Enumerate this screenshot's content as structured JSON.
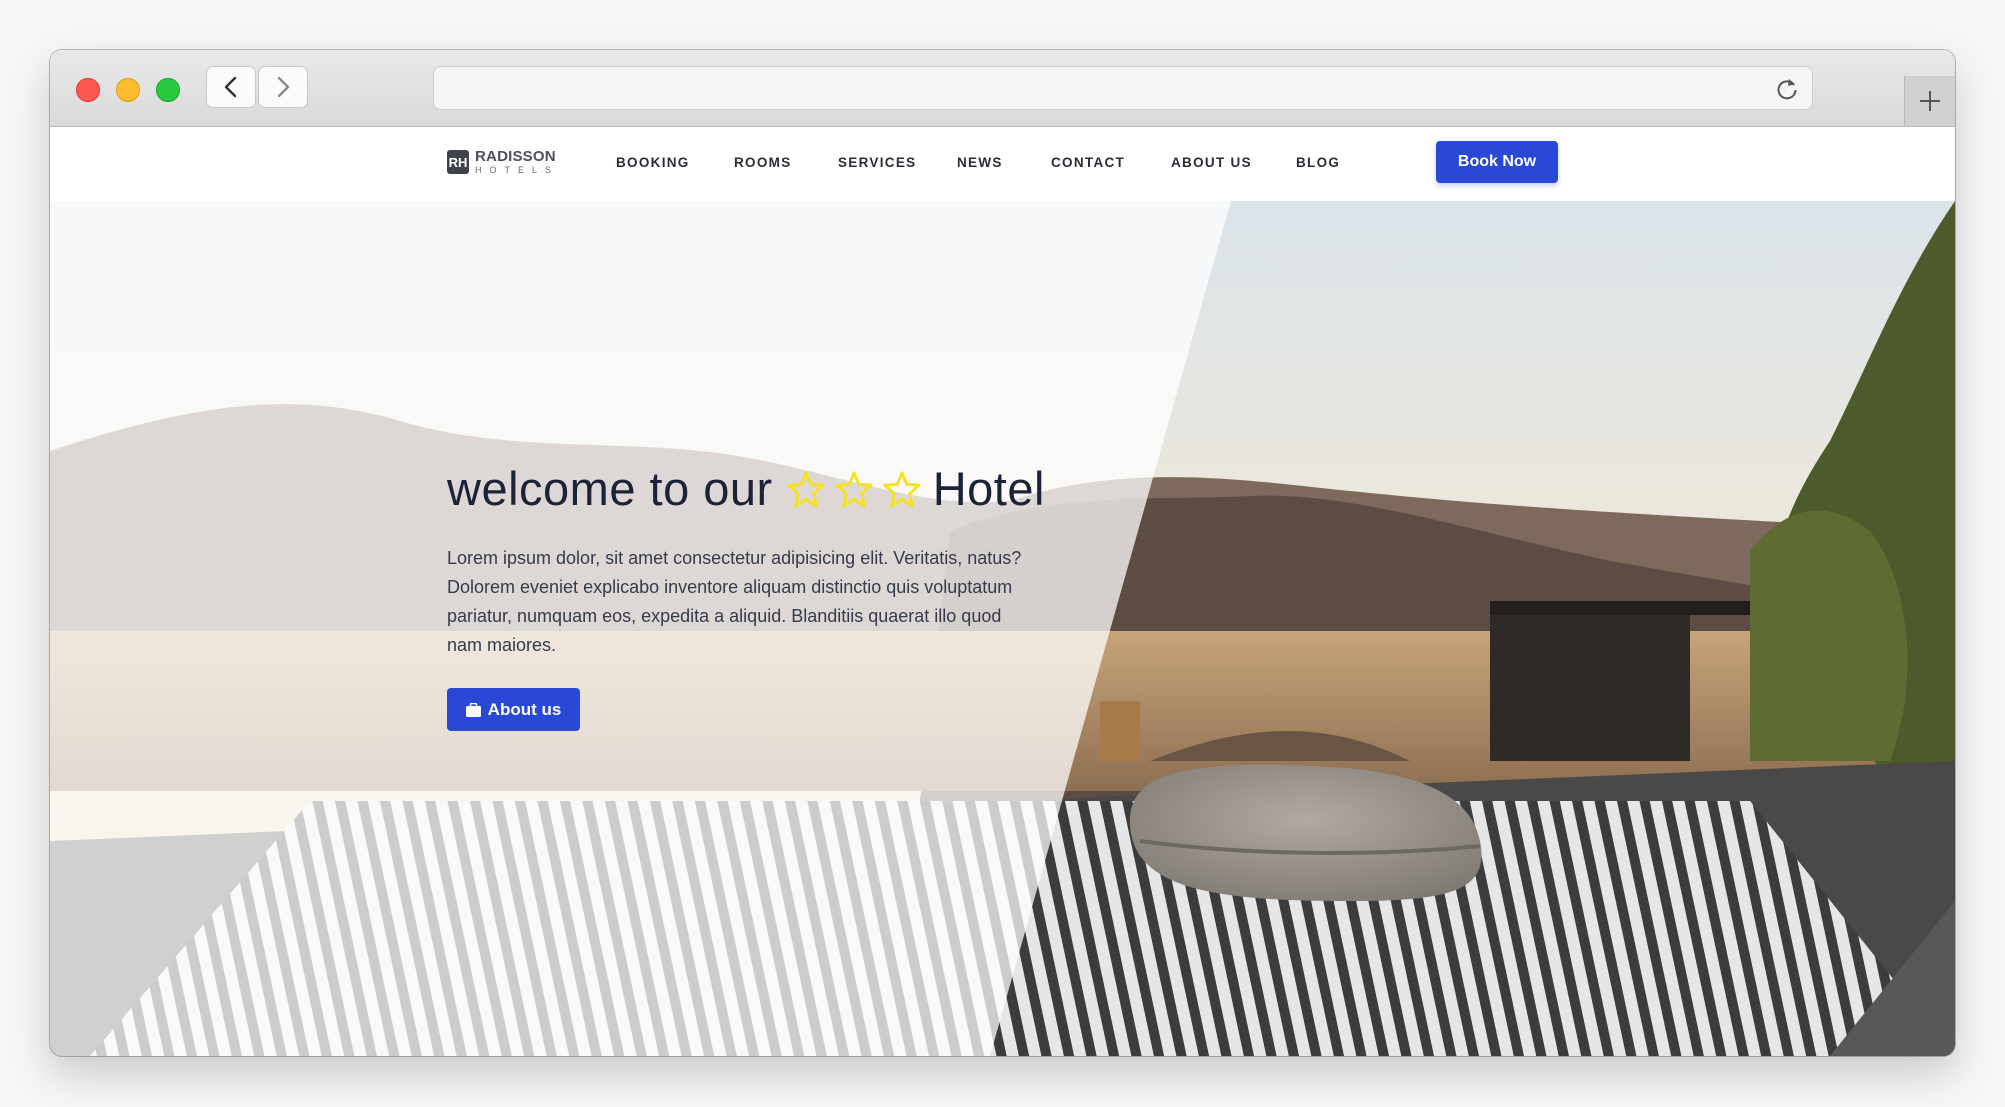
{
  "site": {
    "logo": {
      "name": "RADISSON",
      "sub": "HOTELS",
      "mark": "RH"
    },
    "nav": [
      "BOOKING",
      "ROOMS",
      "SERVICES",
      "NEWS",
      "CONTACT",
      "ABOUT US",
      "BLOG"
    ],
    "book_button": "Book Now"
  },
  "hero": {
    "title_before": "welcome to our",
    "title_after": "Hotel",
    "stars": 3,
    "text": "Lorem ipsum dolor, sit amet consectetur adipisicing elit. Veritatis, natus? Dolorem eveniet explicabo inventore aliquam distinctio quis voluptatum pariatur, numquam eos, expedita a aliquid. Blanditiis quaerat illo quod nam maiores.",
    "button": "About us"
  },
  "colors": {
    "accent": "#2948d6",
    "star": "#f5e21b"
  }
}
